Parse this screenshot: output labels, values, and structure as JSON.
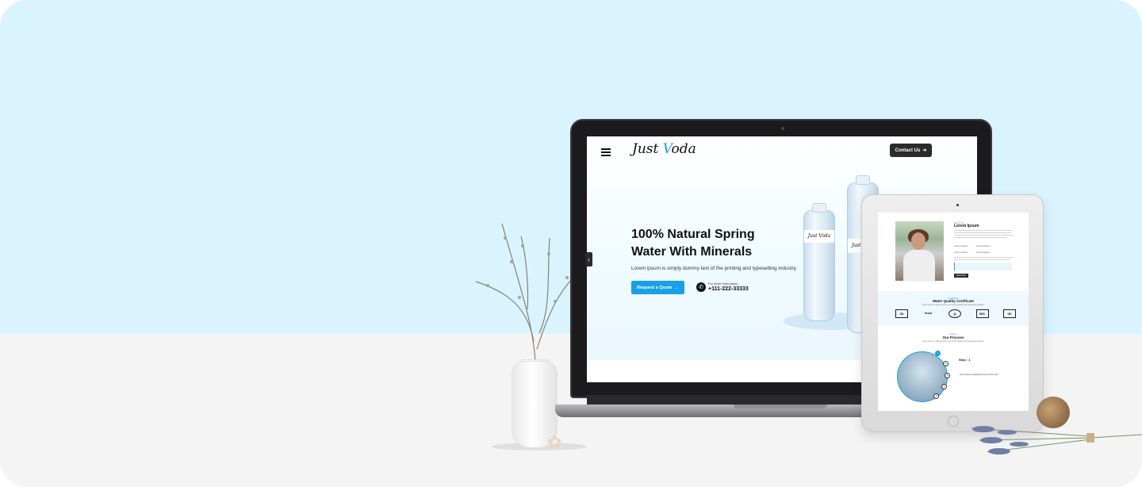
{
  "laptop_site": {
    "logo": {
      "part1": "Just ",
      "v": "V",
      "part2": "oda"
    },
    "contact_button": "Contact Us",
    "hero": {
      "title_line1": "100% Natural Spring",
      "title_line2": "Water With Minerals",
      "subtitle": "Lorem ipsum is simply dummy text of the printing and typesetting industry.",
      "cta": "Request a Quote",
      "phone_label": "For More Information",
      "phone_number": "+111-222-33333"
    },
    "bottle_label": "Just Voda"
  },
  "tablet_site": {
    "about": {
      "tag": "About Us",
      "title": "Lorem Ipsum",
      "checks": [
        "Lorem Ipsum",
        "Lorem Ipsum",
        "Lorem Ipsum",
        "Lorem Ipsum"
      ],
      "button": "Read More"
    },
    "certificates": {
      "tag": "Certification",
      "title": "Water Quality Certificate",
      "subtitle": "Lorem ipsum is simply dummy text of the printing and typesetting industry.",
      "logos": [
        "ISI",
        "fssai",
        "◎",
        "BIS",
        "ISI"
      ]
    },
    "process": {
      "tag": "Process",
      "title": "Our Process",
      "subtitle": "Lorem ipsum is simply dummy text of the printing and typesetting industry.",
      "step_label": "Step : 1",
      "step_heading": "Lorem ipsum is simply dummy text of the print",
      "step_numbers": [
        "1",
        "2",
        "3",
        "4",
        "5"
      ]
    }
  },
  "icons": {
    "menu": "hamburger-icon",
    "arrow": "arrow-right-icon",
    "phone": "phone-icon",
    "chevron": "chevron-left-icon"
  },
  "colors": {
    "sky": "#d9f4ff",
    "floor": "#f4f4f5",
    "accent": "#17a0e6",
    "dark": "#2b2b2d"
  }
}
